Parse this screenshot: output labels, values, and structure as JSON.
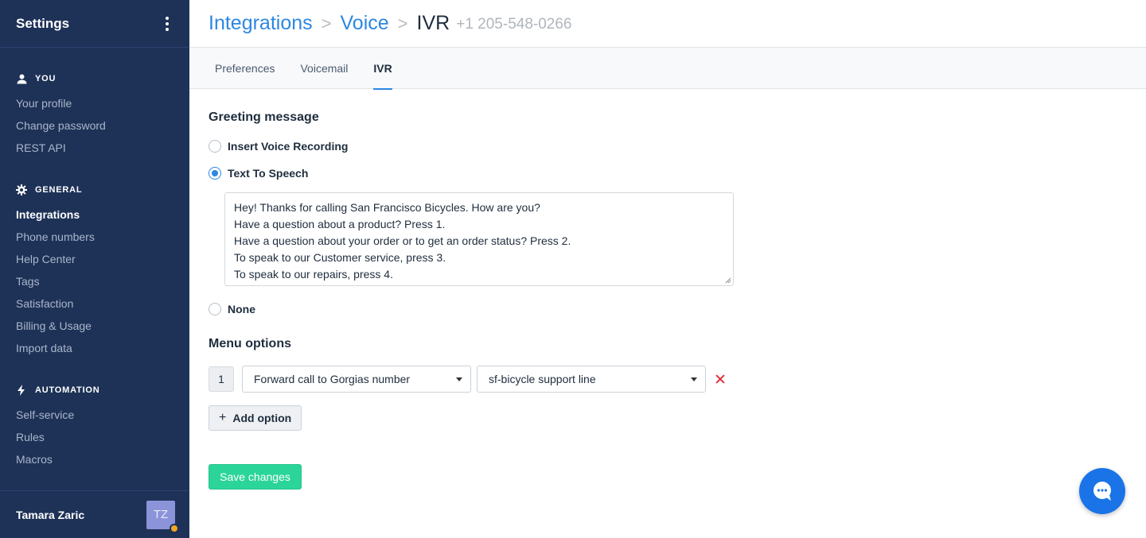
{
  "sidebar": {
    "title": "Settings",
    "sections": [
      {
        "label": "YOU",
        "icon": "user-icon",
        "items": [
          "Your profile",
          "Change password",
          "REST API"
        ]
      },
      {
        "label": "GENERAL",
        "icon": "gear-icon",
        "items": [
          "Integrations",
          "Phone numbers",
          "Help Center",
          "Tags",
          "Satisfaction",
          "Billing & Usage",
          "Import data"
        ]
      },
      {
        "label": "AUTOMATION",
        "icon": "bolt-icon",
        "items": [
          "Self-service",
          "Rules",
          "Macros"
        ]
      }
    ],
    "active_item": "Integrations",
    "user": {
      "name": "Tamara Zaric",
      "initials": "TZ",
      "status_color": "#f5a623"
    }
  },
  "header": {
    "breadcrumb": [
      "Integrations",
      "Voice",
      "IVR"
    ],
    "separator": ">",
    "phone": "+1 205-548-0266"
  },
  "tabs": [
    "Preferences",
    "Voicemail",
    "IVR"
  ],
  "active_tab": "IVR",
  "greeting": {
    "title": "Greeting message",
    "options": [
      "Insert Voice Recording",
      "Text To Speech",
      "None"
    ],
    "selected": "Text To Speech",
    "text_lines": [
      "Hey! Thanks for calling San Francisco Bicycles. How are you?",
      "Have a question about a product? Press 1.",
      "Have a question about your order or to get an order status? Press 2.",
      "To speak to our Customer service, press 3.",
      "To speak to our repairs, press 4."
    ]
  },
  "menu": {
    "title": "Menu options",
    "rows": [
      {
        "number": "1",
        "action": "Forward call to Gorgias number",
        "target": "sf-bicycle support line"
      }
    ],
    "add_label": "Add option"
  },
  "save_label": "Save changes",
  "colors": {
    "sidebar_bg": "#1e3257",
    "accent": "#2d87e2",
    "save": "#2bd59a",
    "delete": "#e0333a",
    "chat": "#1a74e8"
  }
}
